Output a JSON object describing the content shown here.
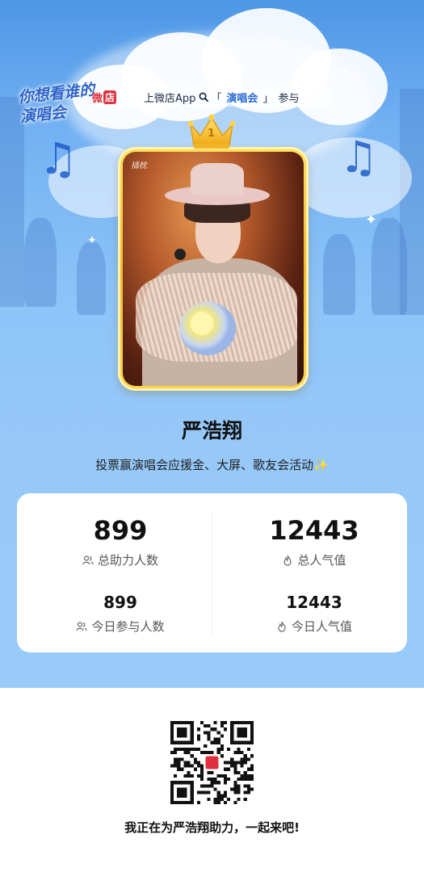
{
  "header": {
    "logo_text": "你想看谁的演唱会",
    "banner": {
      "shop_mark": "微店",
      "text_before": "上微店App",
      "search_open": "「",
      "keyword": "演唱会",
      "search_close": "」",
      "text_after": "参与"
    }
  },
  "rank_badge": "1",
  "photo_watermark": "插枕",
  "artist_name": "严浩翔",
  "tagline": "投票赢演唱会应援金、大屏、歌友会活动✨",
  "stats": {
    "total_support": {
      "value": "899",
      "label": "总助力人数"
    },
    "total_popularity": {
      "value": "12443",
      "label": "总人气值"
    },
    "today_participants": {
      "value": "899",
      "label": "今日参与人数"
    },
    "today_popularity": {
      "value": "12443",
      "label": "今日人气值"
    }
  },
  "invite_text": "我正在为严浩翔助力，一起来吧!",
  "colors": {
    "sky_top": "#4d97e6",
    "sky_bottom": "#99cbf8",
    "gold": "#f6b82c",
    "accent_blue": "#2b6ad6",
    "shop_red": "#e0303e"
  }
}
